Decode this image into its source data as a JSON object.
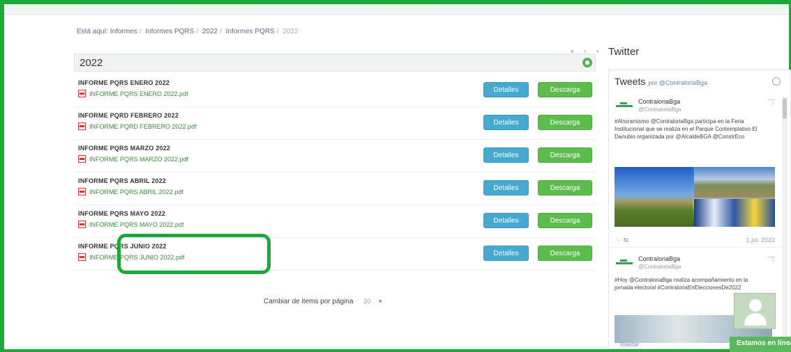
{
  "breadcrumb": {
    "prefix": "Está aquí:",
    "items": [
      "Informes",
      "Informes PQRS",
      "2022",
      "Informes PQRS",
      "2022"
    ]
  },
  "pager": "« ‹ ›",
  "section": {
    "year_title": "2022",
    "rows": [
      {
        "title": "INFORME PQRS ENERO 2022",
        "file": "INFORME PQRS ENERO 2022.pdf",
        "details_label": "Detalles",
        "download_label": "Descarga"
      },
      {
        "title": "INFORME PQRD FEBRERO 2022",
        "file": "INFORME PQRD FEBRERO 2022.pdf",
        "details_label": "Detalles",
        "download_label": "Descarga"
      },
      {
        "title": "INFORME PQRS MARZO 2022",
        "file": "INFORME PQRS MARZO 2022.pdf",
        "details_label": "Detalles",
        "download_label": "Descarga"
      },
      {
        "title": "INFORME PQRS ABRIL 2022",
        "file": "INFORME PQRS ABRIL 2022.pdf",
        "details_label": "Detalles",
        "download_label": "Descarga"
      },
      {
        "title": "INFORME PQRS MAYO 2022",
        "file": "INFORME PQRS MAYO 2022.pdf",
        "details_label": "Detalles",
        "download_label": "Descarga"
      },
      {
        "title": "INFORME PQRS JUNIO 2022",
        "file": "INFORME PQRS JUNIO 2022.pdf",
        "details_label": "Detalles",
        "download_label": "Descarga"
      }
    ]
  },
  "per_page": {
    "label": "Cambiar de items por página",
    "value": "20"
  },
  "twitter": {
    "heading": "Twitter",
    "tweets_label": "Tweets",
    "by_label": "por @ContraloriaBga",
    "tweet1": {
      "name": "ContraloriaBga",
      "handle": "@ContraloriaBga",
      "text": "#Ahoramismo @ContraloriaBga participa en la Feria Institucional que se realiza en el Parque Contemplativo El Danubio organizada por @AlcaldeBGA @ConstrEco",
      "actions": "♡  ⇆",
      "date": "1 jul. 2022"
    },
    "tweet2": {
      "name": "ContraloriaBga",
      "handle": "@ContraloriaBga",
      "text": "#Hoy @ContraloriaBga realiza acompañamiento en la jornada electoral #ContraloriaEnEleccionesDe2022"
    },
    "embed_label": "Insertar"
  },
  "chat": {
    "label": "Estamos en línea"
  },
  "colors": {
    "frame": "#1fa83a",
    "details_button": "#47a9d0",
    "download_button": "#5cbd4c",
    "file_link": "#3d8b3d"
  }
}
